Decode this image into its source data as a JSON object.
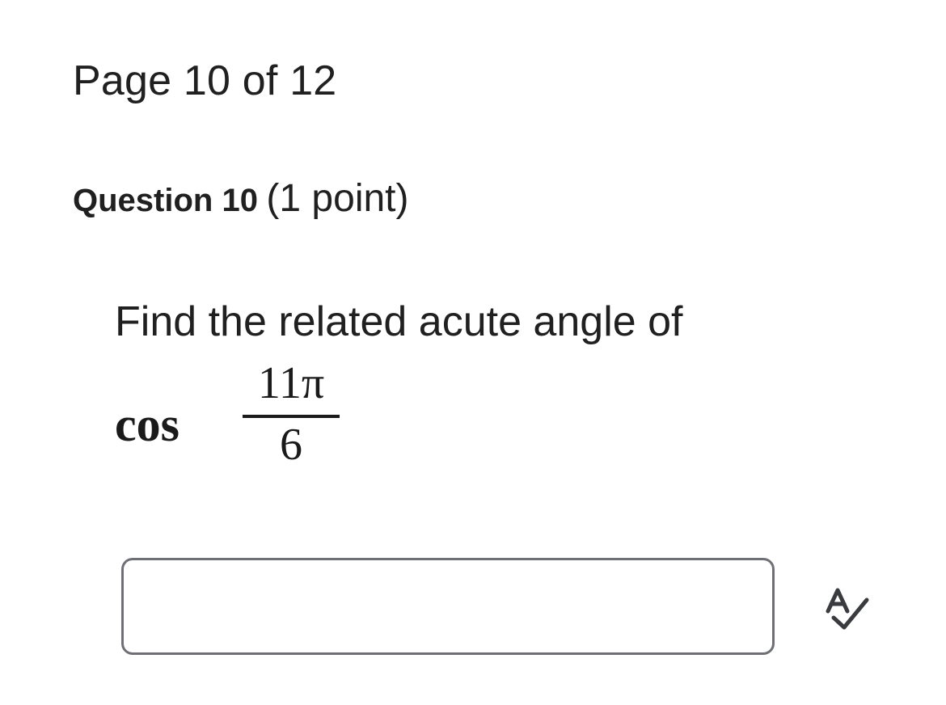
{
  "page": {
    "indicator": "Page 10 of 12"
  },
  "question": {
    "title": "Question 10",
    "points": "(1 point)",
    "prompt": "Find the related acute angle of",
    "math": {
      "function": "cos",
      "numerator": "11π",
      "denominator": "6"
    }
  },
  "answer": {
    "value": "",
    "placeholder": ""
  },
  "icons": {
    "spellcheck": "spellcheck-icon"
  },
  "colors": {
    "text": "#202020",
    "input_border": "#6e7075",
    "icon": "#3a3b3e"
  }
}
